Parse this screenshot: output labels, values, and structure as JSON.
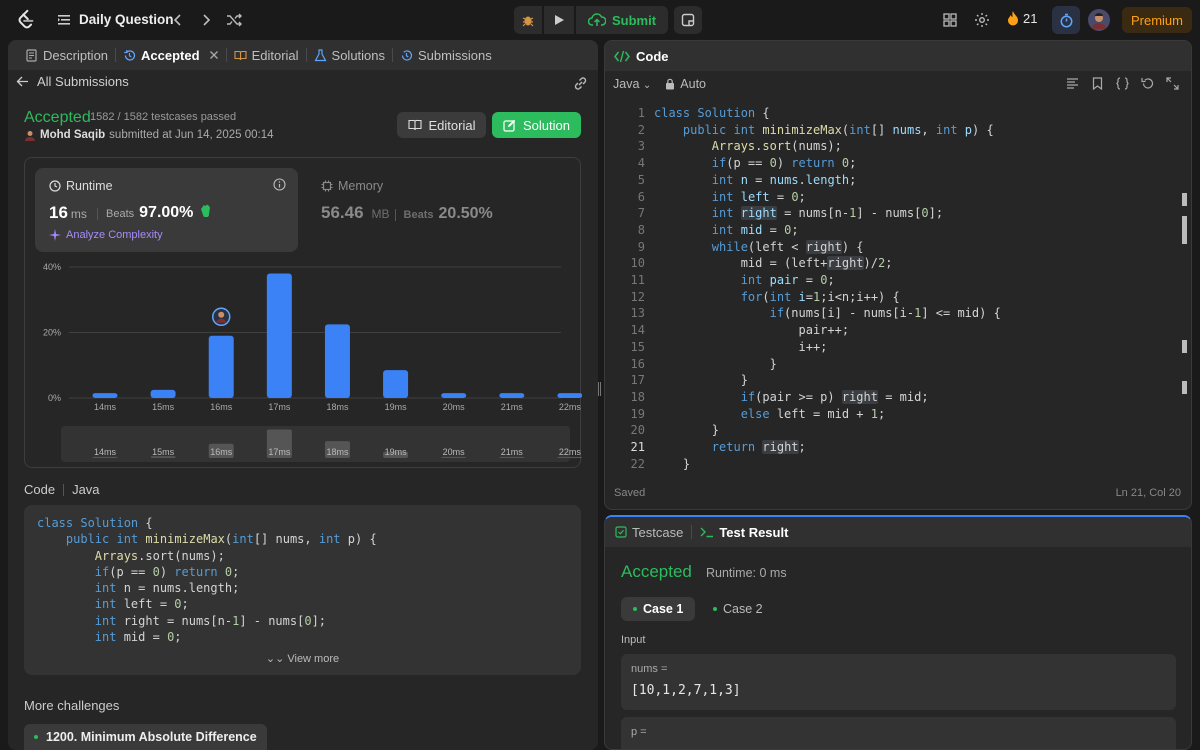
{
  "topbar": {
    "title": "Daily Question",
    "submit_label": "Submit",
    "streak": "21",
    "premium_label": "Premium"
  },
  "left": {
    "tabs": [
      "Description",
      "Accepted",
      "Editorial",
      "Solutions",
      "Submissions"
    ],
    "back_label": "All Submissions",
    "status": "Accepted",
    "testcases": "1582 / 1582 testcases passed",
    "submitter_name": "Mohd Saqib",
    "submitted_at": "submitted at Jun 14, 2025 00:14",
    "editorial_btn": "Editorial",
    "solution_btn": "Solution",
    "runtime": {
      "label": "Runtime",
      "value": "16",
      "unit": "ms",
      "beats_label": "Beats",
      "beats": "97.00%",
      "analyze": "Analyze Complexity"
    },
    "memory": {
      "label": "Memory",
      "value": "56.46",
      "unit": "MB",
      "beats_label": "Beats",
      "beats": "20.50%"
    },
    "code_label": "Code",
    "code_lang": "Java",
    "view_more": "View more",
    "more_challenges": "More challenges",
    "challenge_item": "1200. Minimum Absolute Difference"
  },
  "chart_data": {
    "type": "bar",
    "categories": [
      "14ms",
      "15ms",
      "16ms",
      "17ms",
      "18ms",
      "19ms",
      "20ms",
      "21ms",
      "22ms"
    ],
    "values": [
      1.5,
      2.5,
      19,
      38,
      22.5,
      8.5,
      1.5,
      1.5,
      1.5
    ],
    "ylim": [
      0,
      40
    ],
    "yticks": [
      "0%",
      "20%",
      "40%"
    ],
    "highlight": "16ms",
    "grid": true,
    "colors": {
      "bar": "#3b82f6",
      "grid": "#404040"
    }
  },
  "right": {
    "code_title": "Code",
    "lang": "Java",
    "mode": "Auto",
    "current_line": 21,
    "saved": "Saved",
    "cursor": "Ln 21, Col 20",
    "bottom_tabs": [
      "Testcase",
      "Test Result"
    ],
    "result_status": "Accepted",
    "result_runtime": "Runtime: 0 ms",
    "cases": [
      "Case 1",
      "Case 2"
    ],
    "input_label": "Input",
    "inputs": [
      {
        "name": "nums =",
        "value": "[10,1,2,7,1,3]"
      },
      {
        "name": "p =",
        "value": ""
      }
    ]
  },
  "colors": {
    "accent_green": "#2cbb5d",
    "accent_orange": "#ffa116",
    "accent_blue": "#3b82f6",
    "bg": "#1a1a1a",
    "panel": "#262626"
  }
}
